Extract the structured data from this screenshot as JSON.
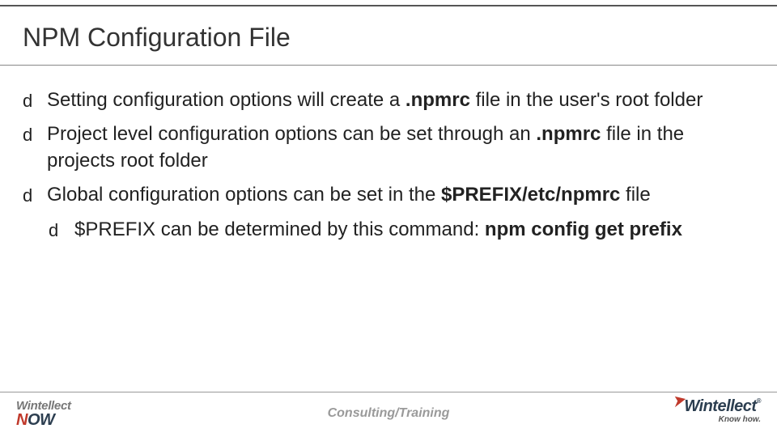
{
  "slide": {
    "title": "NPM Configuration File",
    "bullets": [
      {
        "segments": [
          {
            "t": "Setting configuration options will create a ",
            "b": false
          },
          {
            "t": ".npmrc",
            "b": true
          },
          {
            "t": " file in the user's root folder",
            "b": false
          }
        ]
      },
      {
        "segments": [
          {
            "t": "Project level configuration options can be set through an ",
            "b": false
          },
          {
            "t": ".npmrc",
            "b": true
          },
          {
            "t": " file in the projects root folder",
            "b": false
          }
        ]
      },
      {
        "segments": [
          {
            "t": "Global configuration options can be set in the ",
            "b": false
          },
          {
            "t": "$PREFIX/etc/npmrc",
            "b": true
          },
          {
            "t": " file",
            "b": false
          }
        ],
        "children": [
          {
            "segments": [
              {
                "t": "$PREFIX can be determined by this command: ",
                "b": false
              },
              {
                "t": "npm config get prefix",
                "b": true
              }
            ]
          }
        ]
      }
    ],
    "bullet_glyph": "d"
  },
  "footer": {
    "center": "Consulting/Training",
    "logo_left_line1": "Wintellect",
    "logo_left_line2_a": "N",
    "logo_left_line2_b": "OW",
    "logo_right_line1": "Wintellect",
    "logo_right_reg": "®",
    "logo_right_line2": "Know how."
  }
}
